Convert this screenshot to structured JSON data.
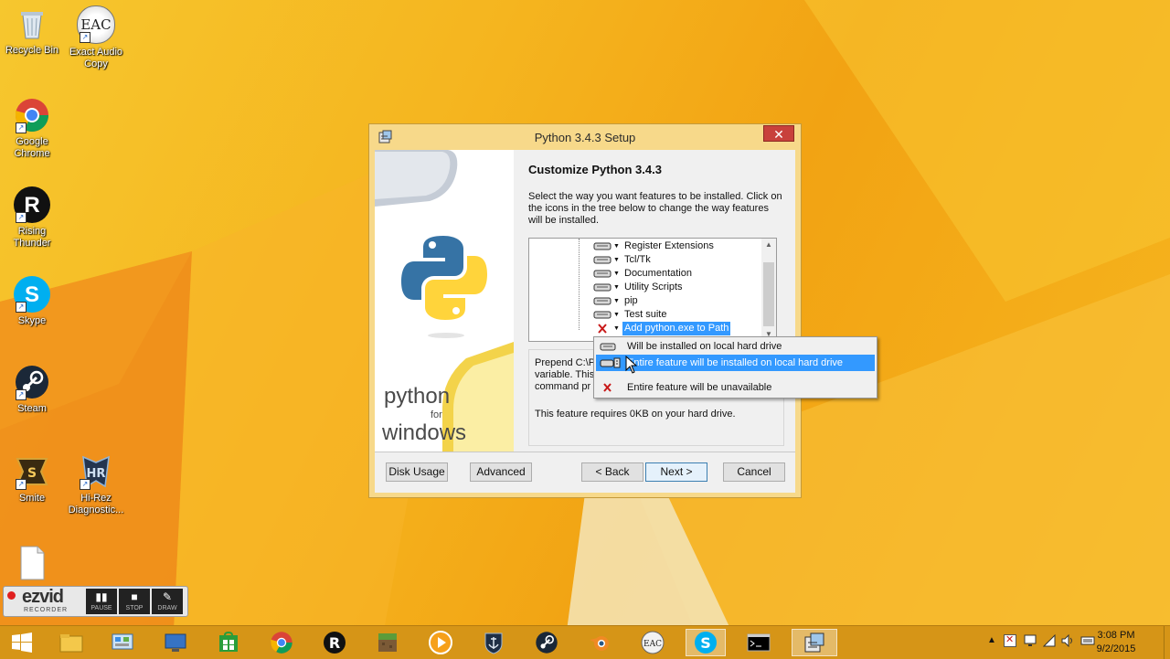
{
  "desktop": {
    "icons": [
      {
        "label": "Recycle Bin"
      },
      {
        "label": "Exact Audio Copy",
        "glyph": "EAC"
      },
      {
        "label": "Google Chrome"
      },
      {
        "label": "Rising Thunder",
        "glyph": "R"
      },
      {
        "label": "Skype",
        "glyph": "S"
      },
      {
        "label": "Steam"
      },
      {
        "label": "Smite"
      },
      {
        "label": "Hi-Rez Diagnostic..."
      },
      {
        "label": ""
      }
    ]
  },
  "dialog": {
    "title": "Python 3.4.3 Setup",
    "close_glyph": "✕",
    "sidebar": {
      "brand_line1": "python",
      "brand_line2": "for",
      "brand_line3": "windows"
    },
    "heading": "Customize Python 3.4.3",
    "description": "Select the way you want features to be installed. Click on the icons in the tree below to change the way features will be installed.",
    "tree": {
      "items": [
        {
          "label": "Register Extensions",
          "state": "drive"
        },
        {
          "label": "Tcl/Tk",
          "state": "drive"
        },
        {
          "label": "Documentation",
          "state": "drive"
        },
        {
          "label": "Utility Scripts",
          "state": "drive"
        },
        {
          "label": "pip",
          "state": "drive"
        },
        {
          "label": "Test suite",
          "state": "drive"
        },
        {
          "label": "Add python.exe to Path",
          "state": "unavailable",
          "selected": true
        }
      ]
    },
    "info": {
      "line1": "Prepend C:\\P",
      "line2": "variable. This",
      "line3": "command pr",
      "requirement": "This feature requires 0KB on your hard drive."
    },
    "buttons": {
      "disk_usage": "Disk Usage",
      "advanced": "Advanced",
      "back": "< Back",
      "next": "Next >",
      "cancel": "Cancel"
    }
  },
  "menu": {
    "items": [
      {
        "label": "Will be installed on local hard drive",
        "icon": "drive-icon"
      },
      {
        "label": "Entire feature will be installed on local hard drive",
        "icon": "drive-stack-icon",
        "highlighted": true
      },
      {
        "label": "Entire feature will be unavailable",
        "icon": "x-icon"
      }
    ]
  },
  "ezvid": {
    "brand": "ezvid",
    "sub": "RECORDER",
    "pause": "PAUSE",
    "stop": "STOP",
    "draw": "DRAW"
  },
  "taskbar": {
    "time": "3:08 PM",
    "date": "9/2/2015"
  },
  "colors": {
    "accent": "#3399ff",
    "desktop": "#f5b01c",
    "taskbar": "#d69517"
  }
}
